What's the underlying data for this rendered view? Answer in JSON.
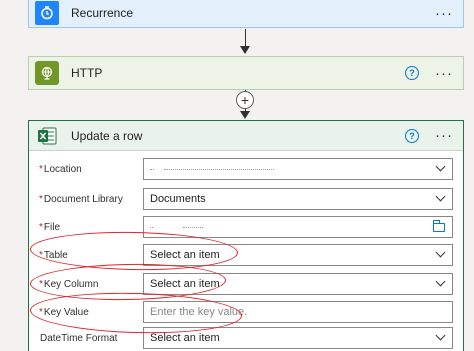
{
  "flow": {
    "recurrence": {
      "title": "Recurrence",
      "icon": "clock-icon",
      "accent": "#1f85ff"
    },
    "http": {
      "title": "HTTP",
      "icon": "globe-icon",
      "accent": "#709727"
    },
    "update_row": {
      "title": "Update a row",
      "icon": "excel-icon",
      "accent": "#217346",
      "fields": [
        {
          "label": "Location",
          "required": "*",
          "value": "",
          "kind": "dropdown"
        },
        {
          "label": "Document Library",
          "required": "*",
          "value": "Documents",
          "kind": "dropdown"
        },
        {
          "label": "File",
          "required": "*",
          "value": "",
          "kind": "file"
        },
        {
          "label": "Table",
          "required": "*",
          "value": "Select an item",
          "kind": "dropdown"
        },
        {
          "label": "Key Column",
          "required": "*",
          "value": "Select an item",
          "kind": "dropdown"
        },
        {
          "label": "Key Value",
          "required": "*",
          "placeholder": "Enter the key value.",
          "kind": "text"
        },
        {
          "label": "DateTime Format",
          "required": "",
          "value": "Select an item",
          "kind": "dropdown"
        }
      ]
    }
  },
  "toolbar": {
    "more": "···",
    "help": "?",
    "add": "+"
  },
  "annotation_color": "#e0242b"
}
